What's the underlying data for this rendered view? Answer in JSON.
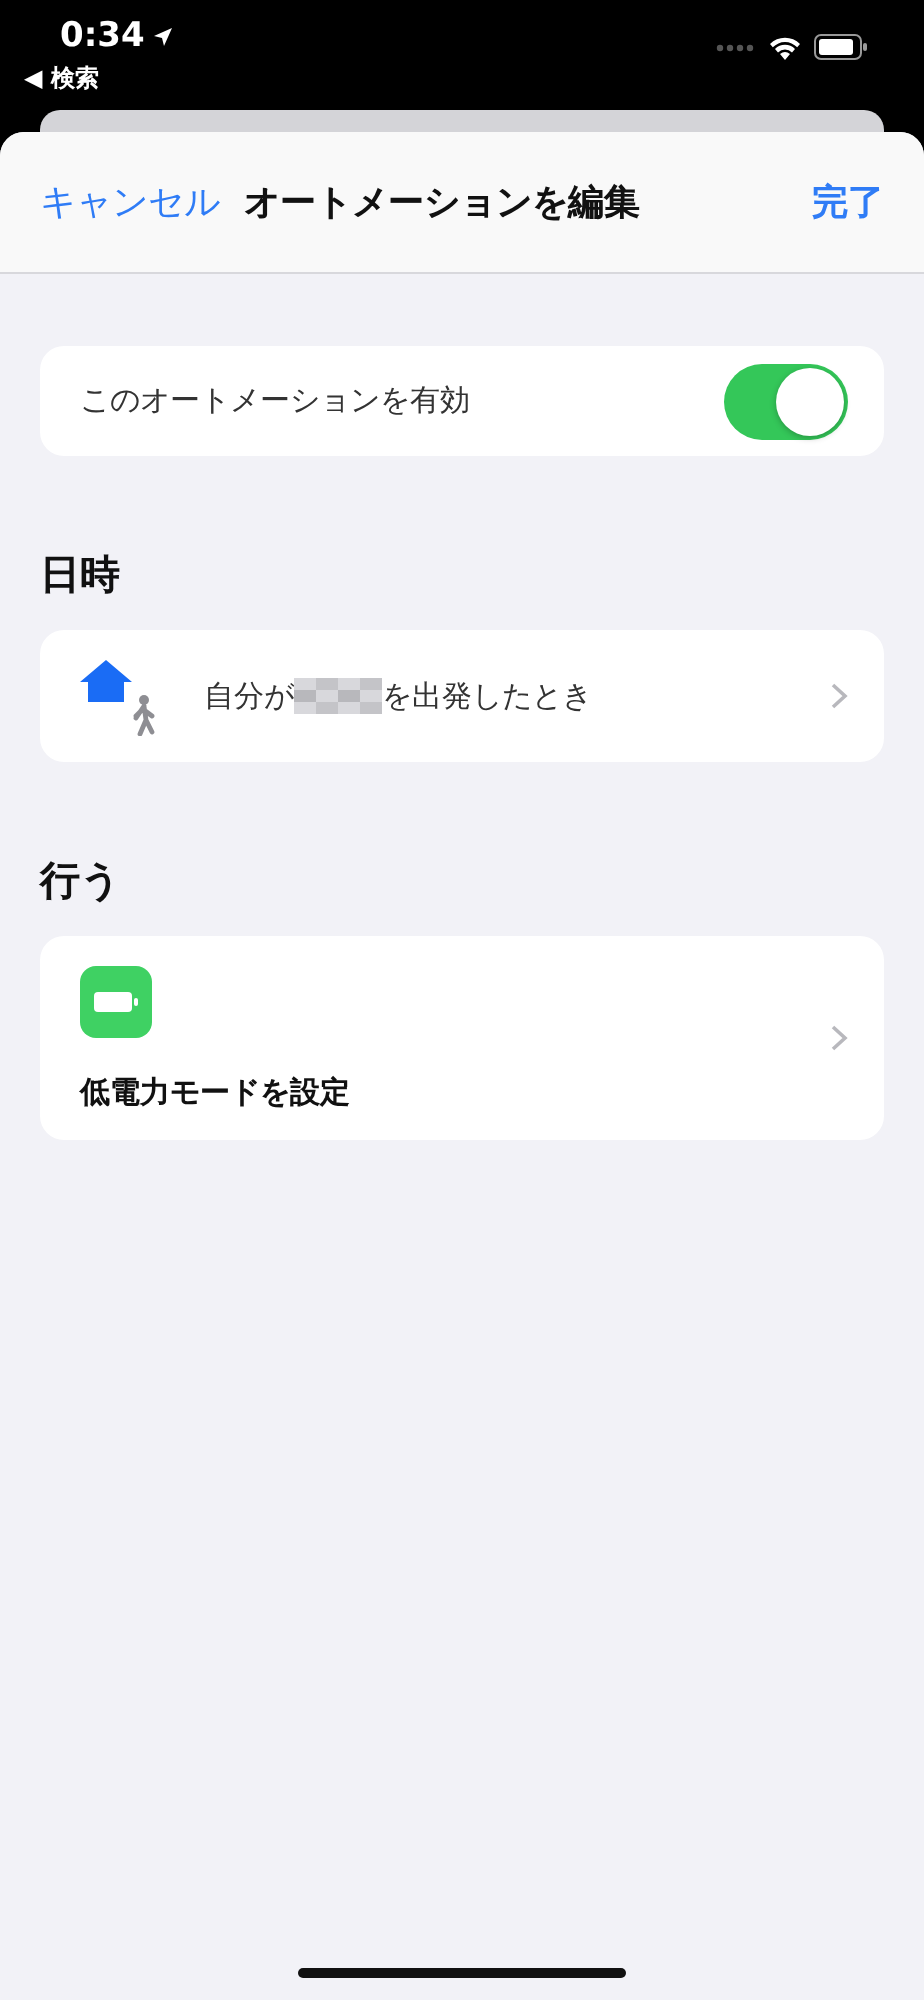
{
  "status_bar": {
    "time": "0:34",
    "back_label": "◀ 検索"
  },
  "nav": {
    "cancel": "キャンセル",
    "title": "オートメーションを編集",
    "done": "完了"
  },
  "enable": {
    "label": "このオートメーションを有効",
    "on": true
  },
  "sections": [
    {
      "header": "日時",
      "kind": "trigger",
      "text_before": "自分が",
      "redacted": true,
      "text_after": "を出発したとき"
    },
    {
      "header": "行う",
      "kind": "action",
      "text": "低電力モードを設定"
    }
  ]
}
